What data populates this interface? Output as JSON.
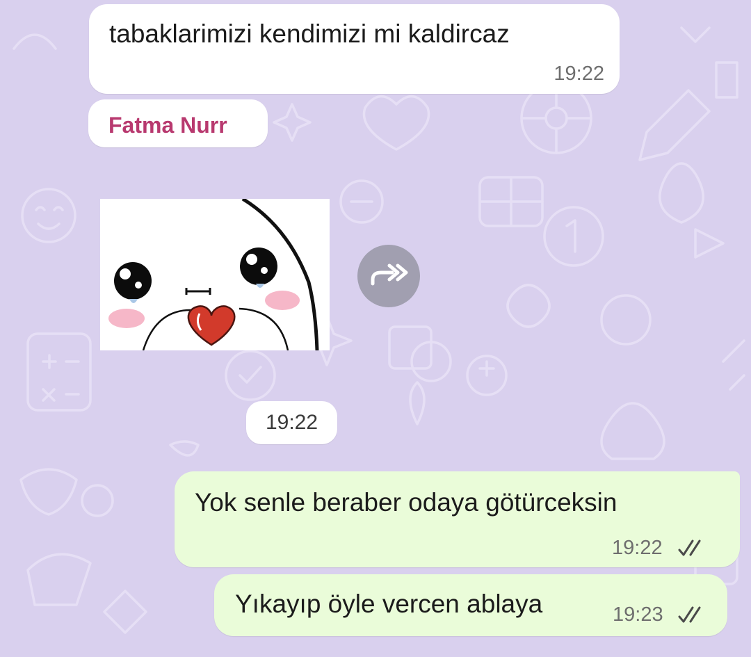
{
  "colors": {
    "wallpaper": "#d9d0ee",
    "incoming_bubble": "#ffffff",
    "outgoing_bubble": "#eafcd9",
    "sender_name": "#b8396f",
    "read_ticks": "#4a4a4a"
  },
  "messages": {
    "m1": {
      "direction": "incoming",
      "text": "tabaklarimizi kendimizi mi kaldircaz",
      "time": "19:22"
    },
    "sender_chip": {
      "name": "Fatma Nurr"
    },
    "sticker": {
      "direction": "incoming",
      "content": "sticker",
      "forward_icon": "forward-icon"
    },
    "m2": {
      "direction": "outgoing",
      "text": "Yok senle beraber odaya götürceksin",
      "time": "19:22",
      "status_icon": "double-check-icon"
    },
    "m3": {
      "direction": "outgoing",
      "text": "Yıkayıp öyle vercen ablaya",
      "time": "19:23",
      "status_icon": "double-check-icon"
    }
  },
  "time_chip": {
    "label": "19:22"
  }
}
